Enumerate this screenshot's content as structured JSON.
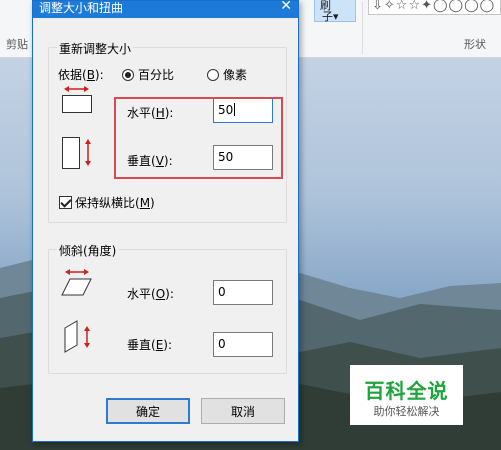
{
  "ribbon": {
    "clipboard_label": "剪贴",
    "brush_label_top": "刷",
    "brush_label": "子",
    "brush_arrow": "▾",
    "shapes_glyphs": "⇩✧☆☆✦◯◯◯◯",
    "shapes_label": "形状"
  },
  "dialog": {
    "title": "调整大小和扭曲",
    "close_glyph": "✕",
    "resize_group": "重新调整大小",
    "by_label": "依据(",
    "by_key": "B",
    "by_end": "):",
    "percent_label": "百分比",
    "pixels_label": "像素",
    "horizontal_label": "水平(",
    "horizontal_key": "H",
    "horizontal_end": "):",
    "horizontal_value": "50",
    "vertical_label": "垂直(",
    "vertical_key": "V",
    "vertical_end": "):",
    "vertical_value": "50",
    "keep_ratio_label": "保持纵横比(",
    "keep_ratio_key": "M",
    "keep_ratio_end": ")",
    "skew_group": "倾斜(角度)",
    "skew_h_label": "水平(",
    "skew_h_key": "O",
    "skew_h_end": "):",
    "skew_h_value": "0",
    "skew_v_label": "垂直(",
    "skew_v_key": "E",
    "skew_v_end": "):",
    "skew_v_value": "0",
    "ok_label": "确定",
    "cancel_label": "取消",
    "percent_selected": true,
    "keep_ratio_checked": true
  },
  "watermark": {
    "main": "百科全说",
    "sub": "助你轻松解决"
  },
  "colors": {
    "title_bar": "#1e7ad8",
    "highlight_box": "#d84a4f",
    "watermark_green": "#1fa33b"
  }
}
